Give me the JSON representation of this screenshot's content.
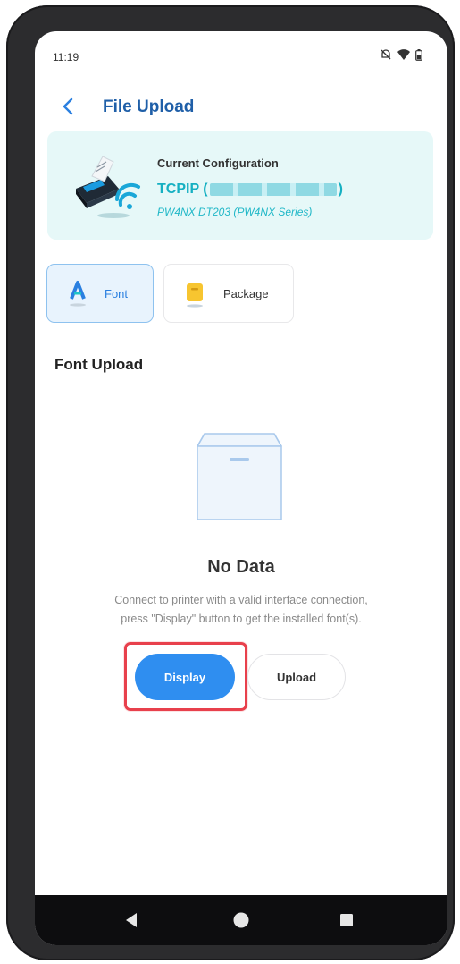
{
  "status_bar": {
    "time": "11:19",
    "icons": [
      "mute-icon",
      "wifi-icon",
      "battery-icon"
    ]
  },
  "header": {
    "title": "File Upload",
    "back_icon": "chevron-left-icon"
  },
  "config": {
    "heading": "Current Configuration",
    "connection_prefix": "TCPIP (",
    "connection_suffix": ")",
    "model": "PW4NX DT203 (PW4NX Series)",
    "icon": "printer-wifi-icon"
  },
  "tabs": [
    {
      "label": "Font",
      "icon": "font-icon",
      "selected": true
    },
    {
      "label": "Package",
      "icon": "package-icon",
      "selected": false
    }
  ],
  "section": {
    "title": "Font Upload"
  },
  "empty_state": {
    "icon": "empty-box-icon",
    "title": "No Data",
    "line1": "Connect to printer with a valid interface connection,",
    "line2": "press \"Display\" button to get the installed font(s)."
  },
  "actions": {
    "display_label": "Display",
    "upload_label": "Upload"
  },
  "navbar": {
    "items": [
      "back-triangle-icon",
      "home-circle-icon",
      "recents-square-icon"
    ]
  },
  "colors": {
    "accent": "#2f8ef0",
    "title_blue": "#1f5fa8",
    "teal": "#16b0c2",
    "card_bg": "#e6f8f8",
    "highlight": "#e8404c"
  }
}
